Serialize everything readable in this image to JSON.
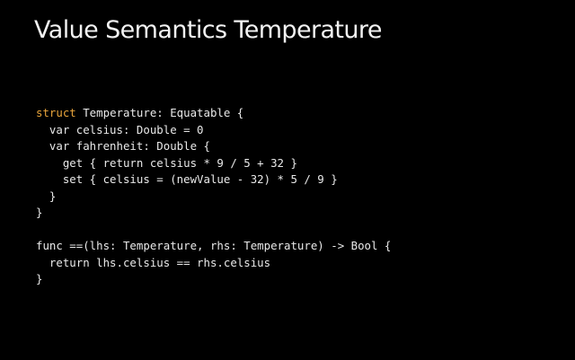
{
  "slide": {
    "title": "Value Semantics Temperature",
    "background_color": "#000000",
    "keyword_color": "#e8a43b",
    "text_color": "#e9e9e9"
  },
  "code": {
    "line1": {
      "keyword": "struct",
      "rest": " Temperature: Equatable {"
    },
    "line2": "  var celsius: Double = 0",
    "line3": "  var fahrenheit: Double {",
    "line4": "    get { return celsius * 9 / 5 + 32 }",
    "line5": "    set { celsius = (newValue - 32) * 5 / 9 }",
    "line6": "  }",
    "line7": "}",
    "line8": "func ==(lhs: Temperature, rhs: Temperature) -> Bool {",
    "line9": "  return lhs.celsius == rhs.celsius",
    "line10": "}"
  }
}
